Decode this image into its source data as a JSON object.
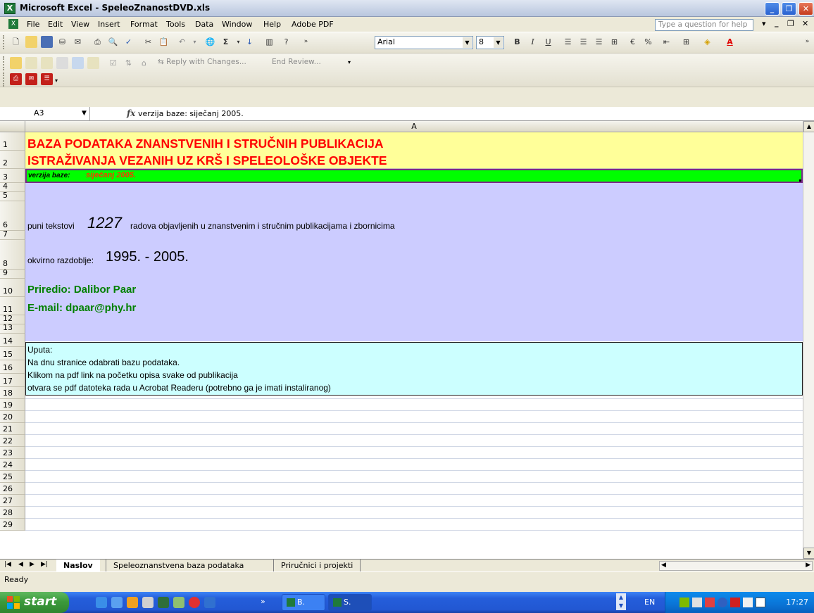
{
  "window": {
    "title": "Microsoft Excel - SpeleoZnanostDVD.xls",
    "minimize": "_",
    "restore": "❐",
    "close": "✕"
  },
  "menu": {
    "items": [
      "File",
      "Edit",
      "View",
      "Insert",
      "Format",
      "Tools",
      "Data",
      "Window",
      "Help",
      "Adobe PDF"
    ],
    "help_placeholder": "Type a question for help"
  },
  "toolbar": {
    "font_name": "Arial",
    "font_size": "8",
    "reply_label": "Reply with Changes...",
    "end_review_label": "End Review..."
  },
  "formula_bar": {
    "name_box": "A3",
    "fx": "fx",
    "content": "verzija baze:  siječanj 2005."
  },
  "grid": {
    "column_header": "A",
    "rows": [
      "1",
      "2",
      "3",
      "4",
      "5",
      "6",
      "7",
      "8",
      "9",
      "10",
      "11",
      "12",
      "13",
      "14",
      "15",
      "16",
      "17",
      "18",
      "19",
      "20",
      "21",
      "22",
      "23",
      "24",
      "25",
      "26",
      "27",
      "28",
      "29"
    ],
    "title_line1": "BAZA PODATAKA ZNANSTVENIH I STRUČNIH PUBLIKACIJA",
    "title_line2": "ISTRAŽIVANJA VEZANIH UZ KRŠ I SPELEOLOŠKE OBJEKTE",
    "version_label": "verzija baze:",
    "version_value": "siječanj 2005.",
    "row6_prefix": "puni tekstovi",
    "row6_count": "1227",
    "row6_suffix": "radova objavljenih u znanstvenim i stručnim publikacijama i zbornicima",
    "row8_prefix": "okvirno razdoblje:",
    "row8_range": "1995. - 2005.",
    "row10": "Priredio: Dalibor Paar",
    "row11": "E-mail: dpaar@phy.hr",
    "row14": "Uputa:",
    "row15": "Na dnu stranice odabrati bazu podataka.",
    "row16": "Klikom na pdf link na početku opisa svake od publikacija",
    "row17": "otvara se pdf datoteka rada u Acrobat Readeru (potrebno ga je imati instaliranog)"
  },
  "sheets": {
    "tabs": [
      "Naslov",
      "Speleoznanstvena baza podataka",
      "Priručnici i projekti"
    ],
    "active": "Naslov"
  },
  "status": {
    "text": "Ready"
  },
  "taskbar": {
    "start": "start",
    "buttons": [
      "B.",
      "S."
    ],
    "lang": "EN",
    "clock": "17:27"
  },
  "colors": {
    "title_red": "#ff0000",
    "header_yellow": "#ffff99",
    "version_green": "#00ff00",
    "info_lavender": "#ccccff",
    "instructions_cyan": "#ccffff",
    "author_green": "#008000"
  }
}
